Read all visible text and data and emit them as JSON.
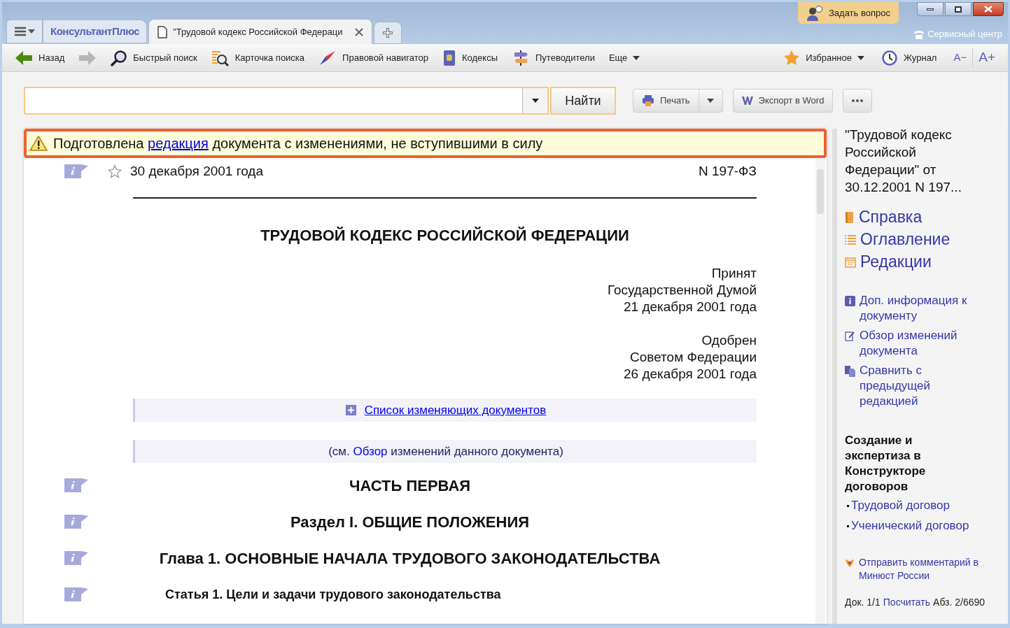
{
  "titlebar": {
    "ask_button": "Задать вопрос",
    "service_center": "Сервисный центр"
  },
  "tabs": [
    {
      "kind": "logo",
      "label": "КонсультантПлюс",
      "selected": false
    },
    {
      "kind": "document",
      "label": "\"Трудовой кодекс Российской Федераци",
      "selected": true
    }
  ],
  "toolbar": {
    "left": [
      {
        "kind": "back",
        "label": "Назад"
      },
      {
        "kind": "forward",
        "disabled": true
      },
      {
        "kind": "quick-search",
        "label": "Быстрый поиск"
      },
      {
        "kind": "search-card",
        "label": "Карточка поиска"
      },
      {
        "kind": "navigator",
        "label": "Правовой навигатор"
      },
      {
        "kind": "codes",
        "label": "Кодексы"
      },
      {
        "kind": "guides",
        "label": "Путеводители"
      },
      {
        "kind": "more",
        "label": "Еще"
      }
    ],
    "right": [
      {
        "kind": "favorites",
        "label": "Избранное"
      },
      {
        "kind": "history",
        "label": "Журнал"
      },
      {
        "kind": "font-smaller",
        "label": "A−"
      },
      {
        "kind": "font-larger",
        "label": "A+"
      }
    ]
  },
  "search": {
    "button": "Найти",
    "print": "Печать",
    "export": "Экспорт в Word"
  },
  "notice": {
    "before": "Подготовлена ",
    "link": "редакция",
    "after": " документа с изменениями, не вступившими в силу"
  },
  "document": {
    "date": "30 декабря 2001 года",
    "number": "N 197-ФЗ",
    "title": "ТРУДОВОЙ КОДЕКС РОССИЙСКОЙ ФЕДЕРАЦИИ",
    "adopted": [
      "Принят",
      "Государственной Думой",
      "21 декабря 2001 года"
    ],
    "approved": [
      "Одобрен",
      "Советом Федерации",
      "26 декабря 2001 года"
    ],
    "changes_list": "Список изменяющих документов",
    "review": {
      "before": "(см. ",
      "link": "Обзор",
      "after": " изменений данного документа)"
    },
    "headings": [
      {
        "kind": "part",
        "text": "ЧАСТЬ ПЕРВАЯ"
      },
      {
        "kind": "section",
        "text": "Раздел I. ОБЩИЕ ПОЛОЖЕНИЯ"
      },
      {
        "kind": "chapter",
        "text": "Глава 1. ОСНОВНЫЕ НАЧАЛА ТРУДОВОГО ЗАКОНОДАТЕЛЬСТВА"
      },
      {
        "kind": "article",
        "text": "Статья 1. Цели и задачи трудового законодательства"
      }
    ]
  },
  "sidebar": {
    "doc_title": "\"Трудовой кодекс Российской Федерации\" от 30.12.2001 N 197...",
    "main_links": [
      {
        "kind": "help",
        "label": "Справка"
      },
      {
        "kind": "contents",
        "label": "Оглавление"
      },
      {
        "kind": "editions",
        "label": "Редакции"
      }
    ],
    "info_links": [
      {
        "kind": "info",
        "label": "Доп. информация к документу"
      },
      {
        "kind": "review",
        "label": "Обзор изменений документа"
      },
      {
        "kind": "compare",
        "label": "Сравнить с предыдущей редакцией"
      }
    ],
    "constructor_title": "Создание и экспертиза в Конструкторе договоров",
    "constructor_links": [
      "Трудовой договор",
      "Ученический договор"
    ],
    "comment_link": "Отправить комментарий в Минюст России",
    "status": {
      "doc": "Док. 1/1",
      "count": "Посчитать",
      "paragraph": "Абз. 2/6690"
    }
  }
}
